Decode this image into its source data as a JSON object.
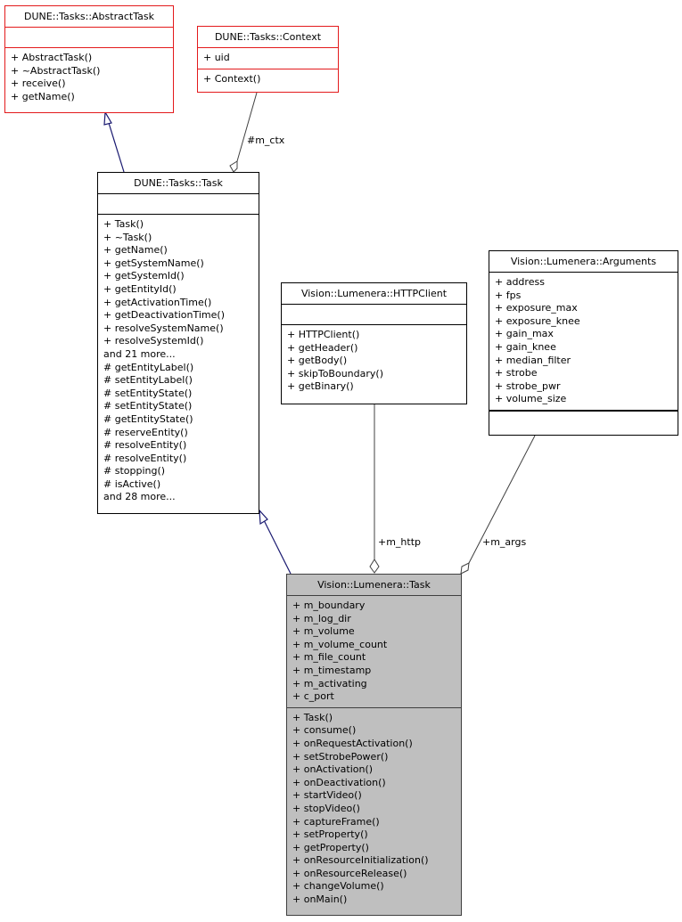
{
  "classes": {
    "abstract_task": {
      "name": "DUNE::Tasks::AbstractTask",
      "attributes": [],
      "methods": [
        "+ AbstractTask()",
        "+ ~AbstractTask()",
        "+ receive()",
        "+ getName()"
      ]
    },
    "context": {
      "name": "DUNE::Tasks::Context",
      "attributes": [
        "+ uid"
      ],
      "methods": [
        "+ Context()"
      ]
    },
    "task": {
      "name": "DUNE::Tasks::Task",
      "attributes": [],
      "methods": [
        "+ Task()",
        "+ ~Task()",
        "+ getName()",
        "+ getSystemName()",
        "+ getSystemId()",
        "+ getEntityId()",
        "+ getActivationTime()",
        "+ getDeactivationTime()",
        "+ resolveSystemName()",
        "+ resolveSystemId()",
        "and 21 more...",
        "# getEntityLabel()",
        "# setEntityLabel()",
        "# setEntityState()",
        "# setEntityState()",
        "# getEntityState()",
        "# reserveEntity()",
        "# resolveEntity()",
        "# resolveEntity()",
        "# stopping()",
        "# isActive()",
        "and 28 more..."
      ]
    },
    "http_client": {
      "name": "Vision::Lumenera::HTTPClient",
      "attributes": [],
      "methods": [
        "+ HTTPClient()",
        "+ getHeader()",
        "+ getBody()",
        "+ skipToBoundary()",
        "+ getBinary()"
      ]
    },
    "arguments": {
      "name": "Vision::Lumenera::Arguments",
      "attributes": [
        "+ address",
        "+ fps",
        "+ exposure_max",
        "+ exposure_knee",
        "+ gain_max",
        "+ gain_knee",
        "+ median_filter",
        "+ strobe",
        "+ strobe_pwr",
        "+ volume_size"
      ],
      "methods": []
    },
    "lumenera_task": {
      "name": "Vision::Lumenera::Task",
      "attributes": [
        "+ m_boundary",
        "+ m_log_dir",
        "+ m_volume",
        "+ m_volume_count",
        "+ m_file_count",
        "+ m_timestamp",
        "+ m_activating",
        "+ c_port"
      ],
      "methods": [
        "+ Task()",
        "+ consume()",
        "+ onRequestActivation()",
        "+ setStrobePower()",
        "+ onActivation()",
        "+ onDeactivation()",
        "+ startVideo()",
        "+ stopVideo()",
        "+ captureFrame()",
        "+ setProperty()",
        "+ getProperty()",
        "+ onResourceInitialization()",
        "+ onResourceRelease()",
        "+ changeVolume()",
        "+ onMain()"
      ]
    }
  },
  "edges": {
    "m_ctx": "#m_ctx",
    "m_http": "+m_http",
    "m_args": "+m_args"
  },
  "colors": {
    "inheritance_edge": "#191970",
    "association_edge": "#404040",
    "external_class_border": "#e31a1c",
    "focus_class_fill": "#bfbfbf"
  }
}
